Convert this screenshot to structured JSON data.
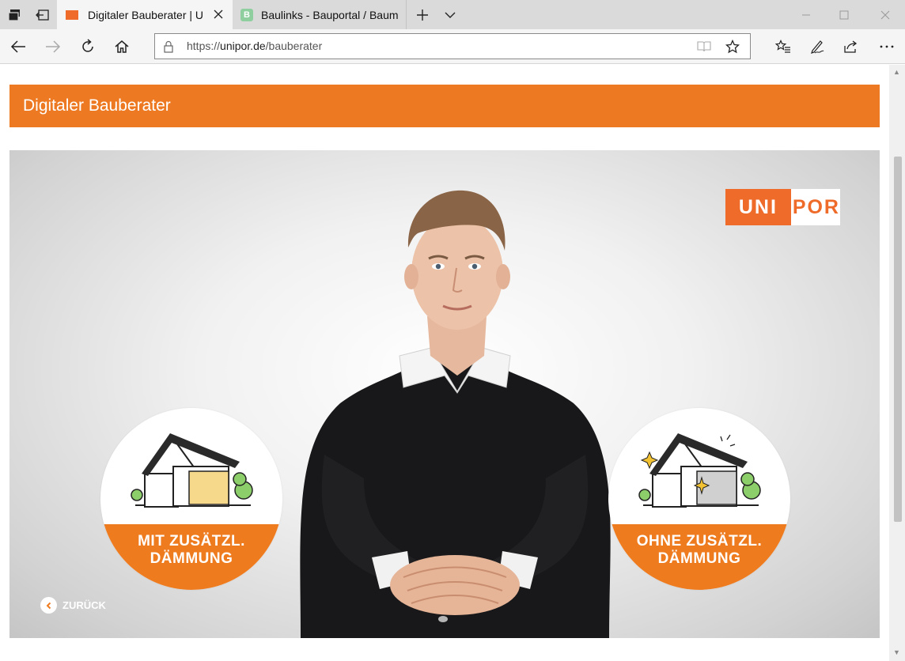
{
  "browser": {
    "tabs": [
      {
        "title": "Digitaler Bauberater | U",
        "active": true
      },
      {
        "title": "Baulinks - Bauportal / Baum",
        "active": false,
        "favicon_letter": "B"
      }
    ],
    "url_prefix": "https://",
    "url_host": "unipor.de",
    "url_path": "/bauberater",
    "icons": [
      "tab-manager-icon",
      "set-aside-icon",
      "back-icon",
      "forward-icon",
      "refresh-icon",
      "home-icon",
      "lock-icon",
      "reading-view-icon",
      "favorite-star-icon",
      "favorites-list-icon",
      "pen-icon",
      "share-icon",
      "more-icon",
      "new-tab-icon",
      "tab-list-icon",
      "minimize-icon",
      "maximize-icon",
      "close-icon"
    ]
  },
  "page": {
    "header_title": "Digitaler Bauberater",
    "logo": {
      "left": "UNI",
      "right": "POR"
    },
    "choices": [
      {
        "line1": "MIT ZUSÄTZL.",
        "line2": "DÄMMUNG"
      },
      {
        "line1": "OHNE ZUSÄTZL.",
        "line2": "DÄMMUNG"
      }
    ],
    "back_label": "ZURÜCK"
  },
  "colors": {
    "accent": "#ED7A22",
    "insulation": "#F7D98B"
  }
}
